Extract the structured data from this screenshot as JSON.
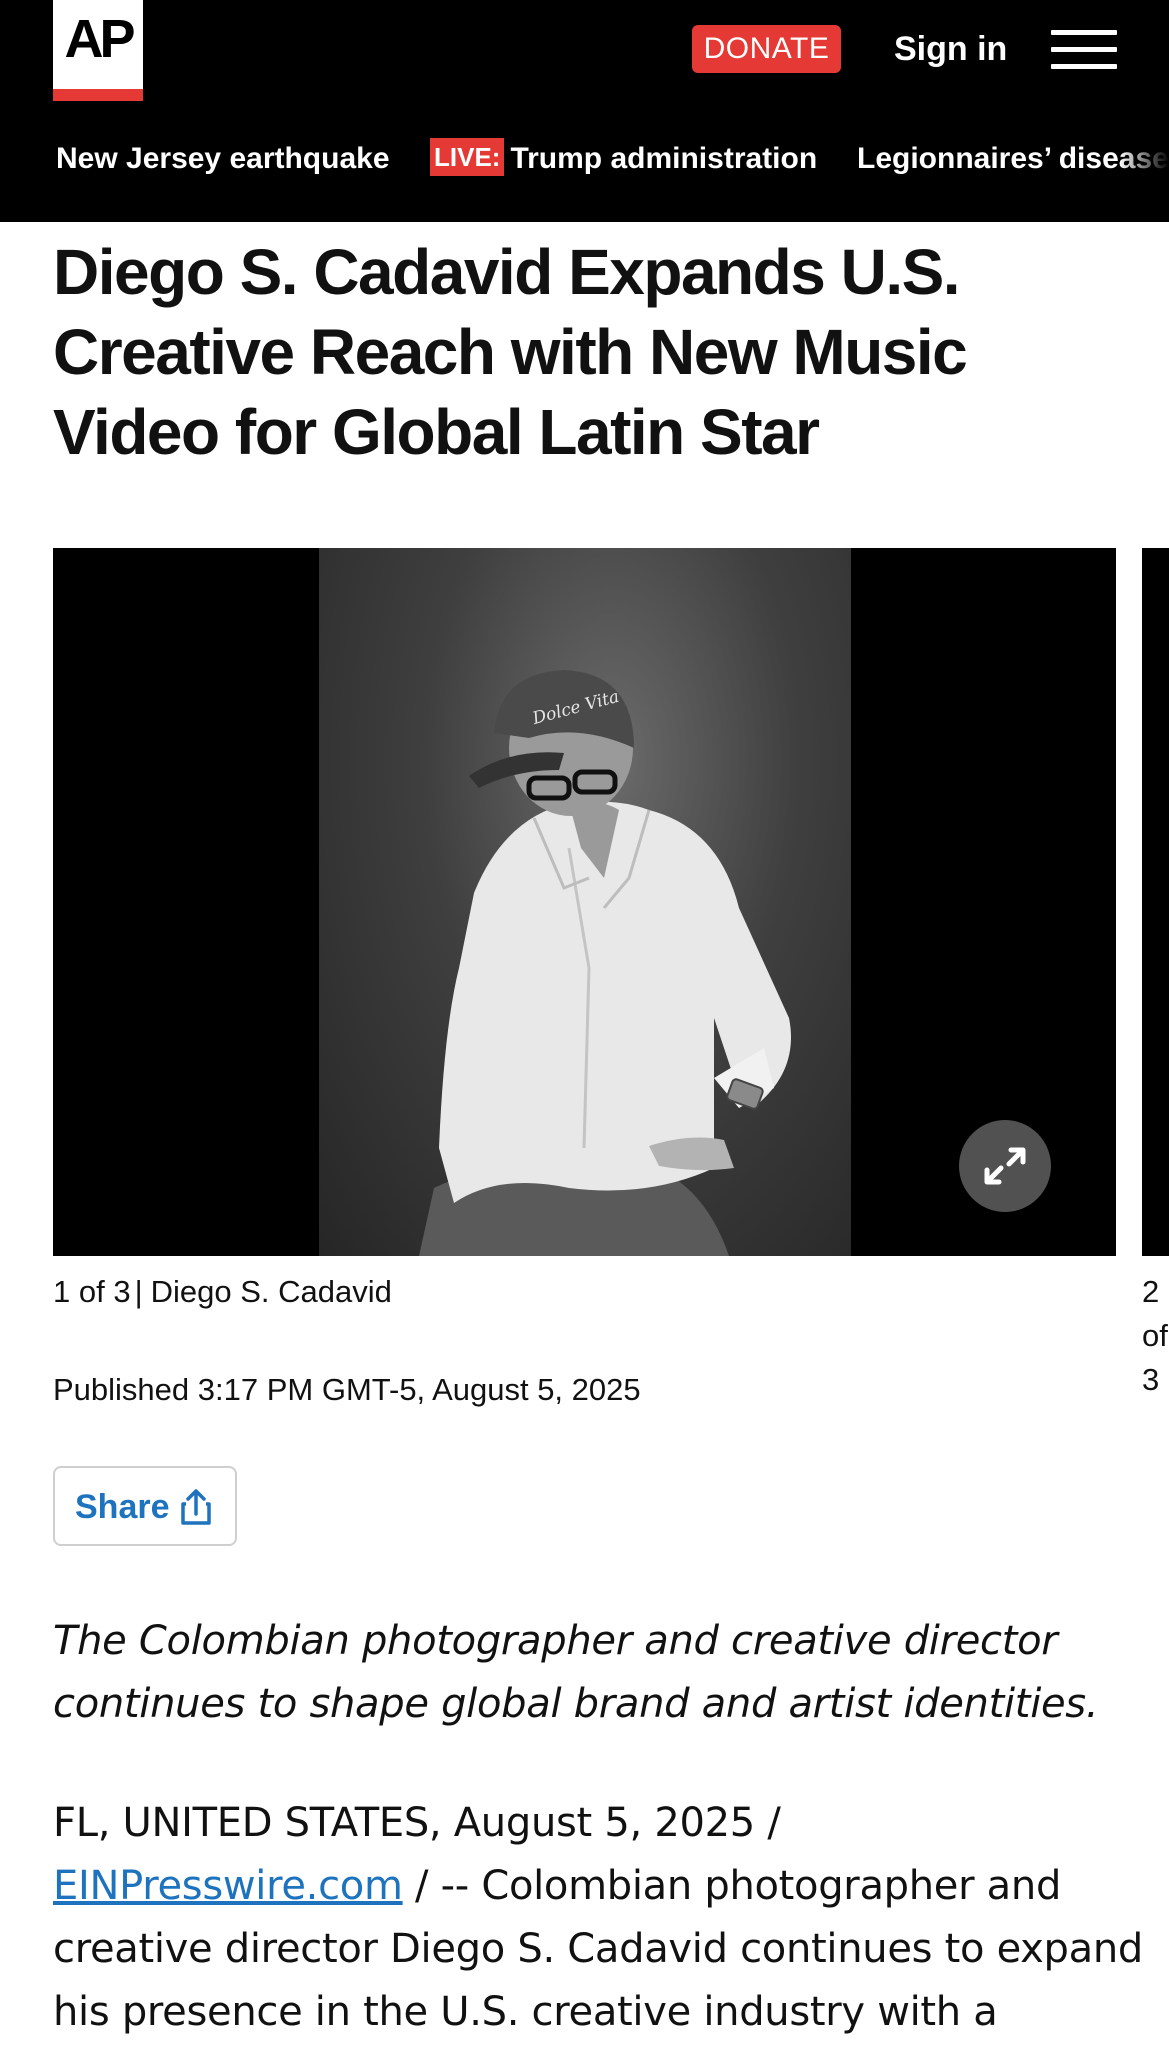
{
  "header": {
    "logo_text": "AP",
    "donate_label": "DONATE",
    "signin_label": "Sign in",
    "menu_icon": "hamburger-menu-icon",
    "colors": {
      "bar": "#000000",
      "accent": "#e53935"
    }
  },
  "nav": {
    "items": [
      {
        "label": "New Jersey earthquake"
      },
      {
        "badge": "LIVE:",
        "label": "Trump administration"
      },
      {
        "label": "Legionnaires’ disease"
      }
    ]
  },
  "article": {
    "headline": "Diego S. Cadavid Expands U.S. Creative Reach with New Music Video for Global Latin Star",
    "gallery": {
      "counter": "1 of 3",
      "separator": "|",
      "caption": "Diego S. Cadavid",
      "next_counter": "2 of 3",
      "expand_icon": "expand-arrows-icon",
      "cap_text": "Dolce Vita"
    },
    "published": "Published 3:17 PM GMT-5, August 5, 2025",
    "share_label": "Share",
    "share_icon": "share-upload-icon",
    "dek": "The Colombian photographer and creative director continues to shape global brand and artist identities.",
    "body": {
      "dateline": "FL, UNITED STATES, August 5, 2025 /",
      "link_text": "EINPresswire.com",
      "text": " / -- Colombian photographer and creative director Diego S. Cadavid continues to expand his presence in the U.S. creative industry with a",
      "link_color": "#1e73be"
    }
  }
}
